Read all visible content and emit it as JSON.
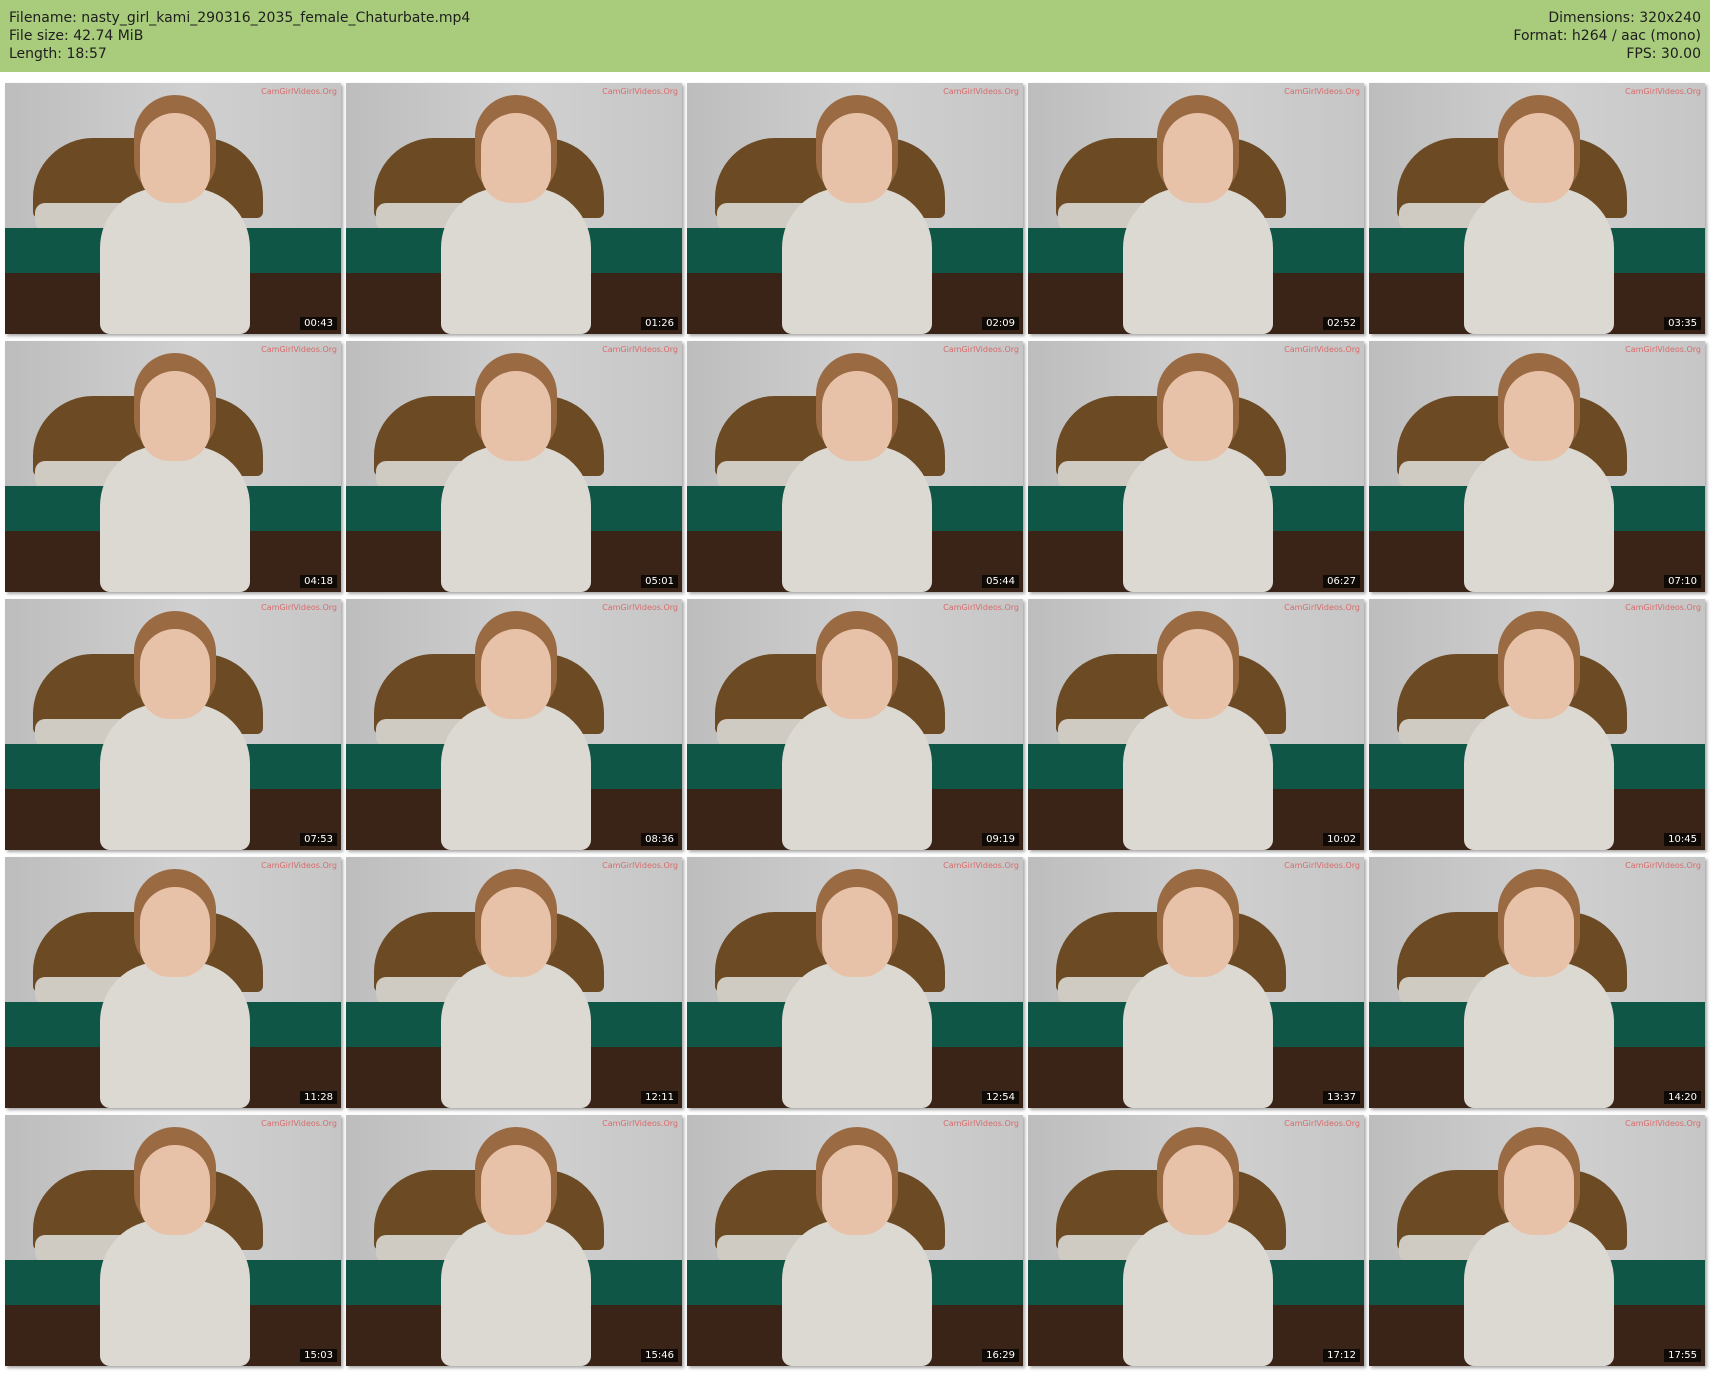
{
  "header": {
    "filename_line": "Filename: nasty_girl_kami_290316_2035_female_Chaturbate.mp4",
    "filesize_line": "File size: 42.74 MiB",
    "length_line": "Length: 18:57",
    "dimensions_line": "Dimensions: 320x240",
    "format_line": "Format: h264 / aac (mono)",
    "fps_line": "FPS: 30.00",
    "background_color": "#a9cb7c"
  },
  "watermark": "CamGirlVideos.Org",
  "timestamps": [
    "00:43",
    "01:26",
    "02:09",
    "02:52",
    "03:35",
    "04:18",
    "05:01",
    "05:44",
    "06:27",
    "07:10",
    "07:53",
    "08:36",
    "09:19",
    "10:02",
    "10:45",
    "11:28",
    "12:11",
    "12:54",
    "13:37",
    "14:20",
    "15:03",
    "15:46",
    "16:29",
    "17:12",
    "17:55"
  ]
}
